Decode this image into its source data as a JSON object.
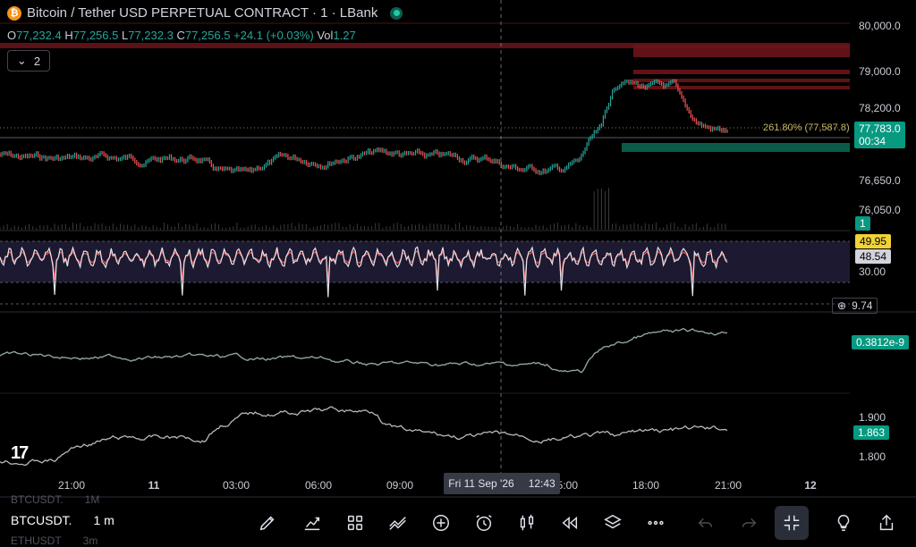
{
  "header": {
    "coin_glyph": "₿",
    "title": "Bitcoin / Tether USD PERPETUAL CONTRACT · 1 · LBank",
    "ohlc": {
      "o_label": "O",
      "o": "77,232.4",
      "h_label": "H",
      "h": "77,256.5",
      "l_label": "L",
      "l": "77,232.3",
      "c_label": "C",
      "c": "77,256.5",
      "change": "+24.1 (+0.03%)",
      "vol_label": "Vol",
      "vol": "1.27"
    },
    "collapse_count": "2"
  },
  "price_axis": {
    "ticks": [
      "80,000.0",
      "79,000.0",
      "78,200.0",
      "76,650.0",
      "76,050.0"
    ],
    "last_price": "77,783.0",
    "countdown": "00:34",
    "volume_tag": "1"
  },
  "fib_label": "261.80% (77,587.8)",
  "oscillator": {
    "value_a": "49.95",
    "value_b": "48.54",
    "level": "30.00",
    "extra_value": "9.74"
  },
  "pane3": {
    "value": "0.3812e-9"
  },
  "pane4": {
    "ticks": [
      "1.900",
      "1.800"
    ],
    "value": "1.863"
  },
  "time_axis": [
    "21:00",
    "11",
    "03:00",
    "06:00",
    "09:00",
    "15:00",
    "18:00",
    "21:00",
    "12"
  ],
  "crosshair": {
    "date": "Fri 11 Sep '26",
    "time": "12:43"
  },
  "watchlist": [
    {
      "symbol": "BTCUSDT.",
      "interval": "1M"
    },
    {
      "symbol": "BTCUSDT.",
      "interval": "1 m"
    },
    {
      "symbol": "ETHUSDT",
      "interval": "3m"
    }
  ],
  "toolbar_icons": [
    "pencil-icon",
    "indicators-icon",
    "grid-icon",
    "compare-icon",
    "plus-circle-icon",
    "alarm-icon",
    "candles-icon",
    "replay-icon",
    "layers-icon",
    "more-icon",
    "undo-icon",
    "redo-icon",
    "fullscreen-exit-icon",
    "lightbulb-icon",
    "share-icon"
  ],
  "colors": {
    "up": "#26a69a",
    "down": "#ef5350",
    "accent_teal": "#089981",
    "yellow": "#f2d335",
    "gray_tag": "#d1d4dc",
    "line_white": "#e0e3eb"
  }
}
